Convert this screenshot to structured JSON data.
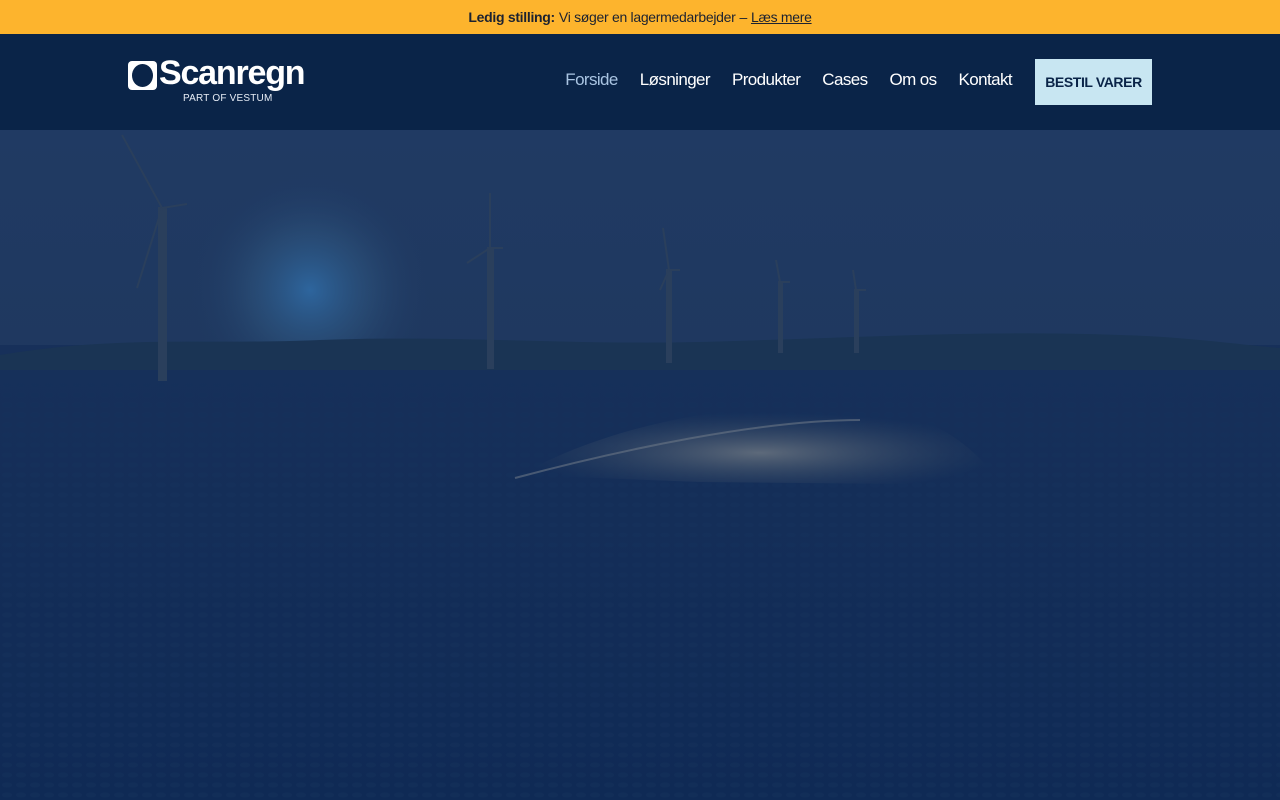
{
  "announcement": {
    "lead": "Ledig stilling:",
    "message": "Vi søger en lagermedarbejder",
    "separator": "–",
    "link": "Læs mere"
  },
  "brand": {
    "name": "Scanregn",
    "tagline": "PART OF VESTUM"
  },
  "nav": {
    "items": [
      {
        "label": "Forside",
        "active": true
      },
      {
        "label": "Løsninger"
      },
      {
        "label": "Produkter"
      },
      {
        "label": "Cases"
      },
      {
        "label": "Om os"
      },
      {
        "label": "Kontakt"
      }
    ],
    "cta": "BESTIL VARER"
  },
  "colors": {
    "announcement_bg": "#fdb42d",
    "header_bg": "#0a2448",
    "cta_bg": "#c8e6f2",
    "active_nav": "#a9c4e2"
  }
}
